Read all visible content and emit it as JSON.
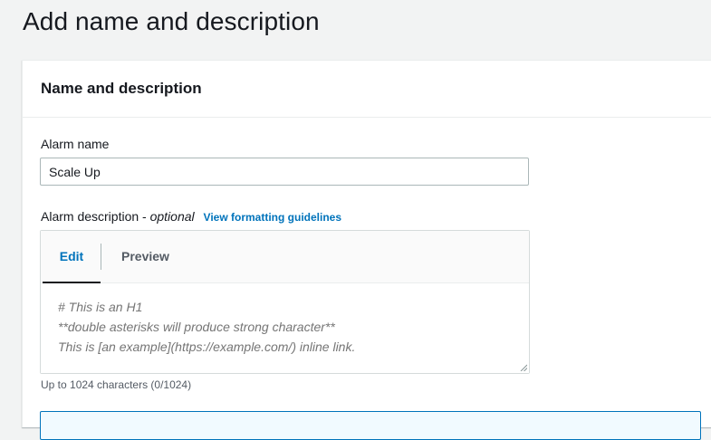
{
  "page": {
    "title": "Add name and description"
  },
  "panel": {
    "title": "Name and description"
  },
  "alarm_name": {
    "label": "Alarm name",
    "value": "Scale Up"
  },
  "alarm_description": {
    "label": "Alarm description - ",
    "optional": "optional",
    "guidelines_link": "View formatting guidelines",
    "tabs": {
      "edit": "Edit",
      "preview": "Preview"
    },
    "placeholder": "# This is an H1\n**double asterisks will produce strong character**\nThis is [an example](https://example.com/) inline link.",
    "char_hint": "Up to 1024 characters (0/1024)"
  },
  "colors": {
    "link": "#0073bb",
    "text": "#16191f",
    "muted": "#545b64",
    "background": "#f2f3f3"
  }
}
